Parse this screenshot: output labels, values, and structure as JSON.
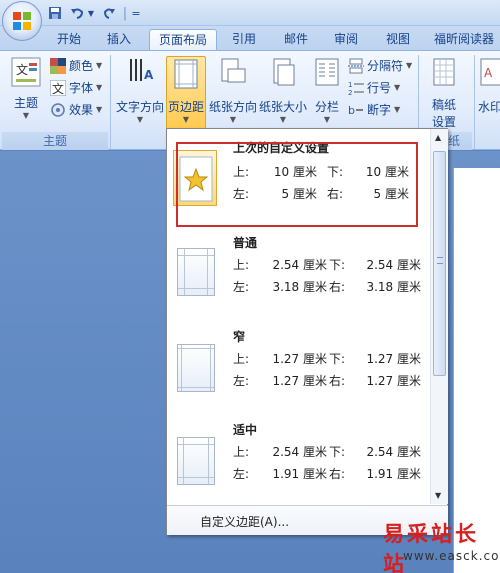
{
  "quick_access": {
    "save_icon": "save-icon",
    "undo_icon": "undo-icon",
    "redo_icon": "repeat-icon",
    "sep": "|",
    "customize": "="
  },
  "tabs": [
    "开始",
    "插入",
    "页面布局",
    "引用",
    "邮件",
    "审阅",
    "视图",
    "福昕阅读器"
  ],
  "active_tab": "页面布局",
  "ribbon": {
    "theme_group": {
      "theme_label": "主题",
      "colors_label": "颜色",
      "fonts_label": "字体",
      "effects_label": "效果",
      "group_label": "主题"
    },
    "page_setup": {
      "text_direction": "文字方向",
      "margins": "页边距",
      "orientation": "纸张方向",
      "size": "纸张大小",
      "columns": "分栏",
      "breaks": "分隔符",
      "line_numbers": "行号",
      "hyphenation": "断字"
    },
    "manuscript": {
      "label_line1": "稿纸",
      "label_line2": "设置",
      "group_label": "纸"
    },
    "watermark_partial": "水印"
  },
  "margins_menu": {
    "items": [
      {
        "title": "上次的自定义设置",
        "top_label": "上:",
        "top": "10 厘米",
        "bottom_label": "下:",
        "bottom": "10 厘米",
        "left_label": "左:",
        "left": "5 厘米",
        "right_label": "右:",
        "right": "5 厘米",
        "selected": true
      },
      {
        "title": "普通",
        "top_label": "上:",
        "top": "2.54 厘米",
        "bottom_label": "下:",
        "bottom": "2.54 厘米",
        "left_label": "左:",
        "left": "3.18 厘米",
        "right_label": "右:",
        "right": "3.18 厘米"
      },
      {
        "title": "窄",
        "top_label": "上:",
        "top": "1.27 厘米",
        "bottom_label": "下:",
        "bottom": "1.27 厘米",
        "left_label": "左:",
        "left": "1.27 厘米",
        "right_label": "右:",
        "right": "1.27 厘米"
      },
      {
        "title": "适中",
        "top_label": "上:",
        "top": "2.54 厘米",
        "bottom_label": "下:",
        "bottom": "2.54 厘米",
        "left_label": "左:",
        "left": "1.91 厘米",
        "right_label": "右:",
        "right": "1.91 厘米"
      }
    ],
    "custom_margins": "自定义边距(A)..."
  },
  "watermark": {
    "text": "易采站长站",
    "url": "www.easck.com"
  },
  "colors": {
    "highlight": "#cc2d2d",
    "ribbon_text": "#15428b",
    "doc_bg": "#5d85bf"
  }
}
